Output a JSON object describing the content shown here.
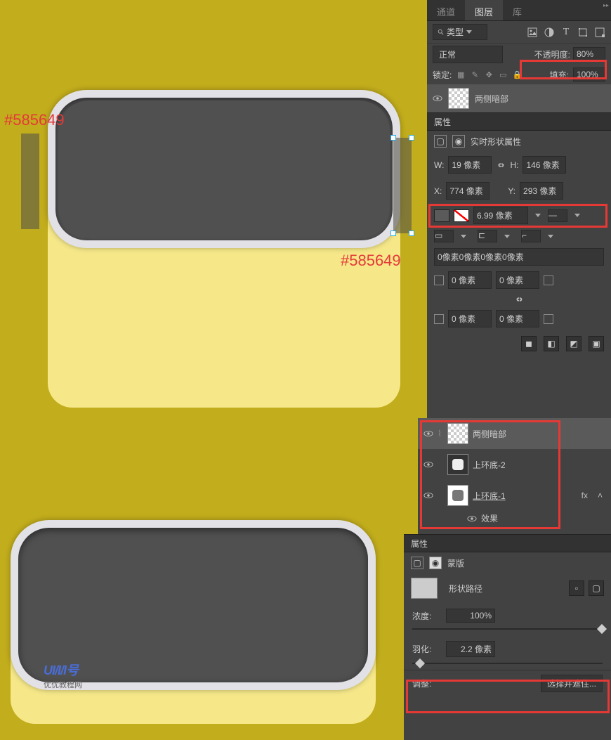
{
  "colors": {
    "annotation": "#585649"
  },
  "tabs": {
    "channels": "通道",
    "layers": "图层",
    "library": "库"
  },
  "filter": {
    "label": "类型"
  },
  "blend": {
    "mode": "正常",
    "opacity_label": "不透明度:",
    "opacity_value": "80%"
  },
  "lock": {
    "label": "锁定:",
    "fill_label": "填充:",
    "fill_value": "100%"
  },
  "layer1": {
    "name": "两侧暗部"
  },
  "properties": {
    "title": "属性",
    "live_shape": "实时形状属性"
  },
  "dims": {
    "w_label": "W:",
    "w_value": "19 像素",
    "h_label": "H:",
    "h_value": "146 像素",
    "x_label": "X:",
    "x_value": "774 像素",
    "y_label": "Y:",
    "y_value": "293 像素"
  },
  "stroke": {
    "width": "6.99 像素"
  },
  "radius": {
    "combined": "0像素0像素0像素0像素",
    "r1": "0 像素",
    "r2": "0 像素",
    "r3": "0 像素",
    "r4": "0 像素"
  },
  "layers2": {
    "a": "两侧暗部",
    "b": "上环底-2",
    "c": "上环底-1",
    "fx": "效果",
    "fx_label": "fx"
  },
  "mask": {
    "title": "属性",
    "sub": "蒙版",
    "shape_path": "形状路径",
    "density_label": "浓度:",
    "density_value": "100%",
    "feather_label": "羽化:",
    "feather_value": "2.2 像素",
    "adjust": "调整:",
    "select": "选择并遮住..."
  },
  "watermark": {
    "brand": "UI/I/I号",
    "sub": "优优教程网"
  }
}
